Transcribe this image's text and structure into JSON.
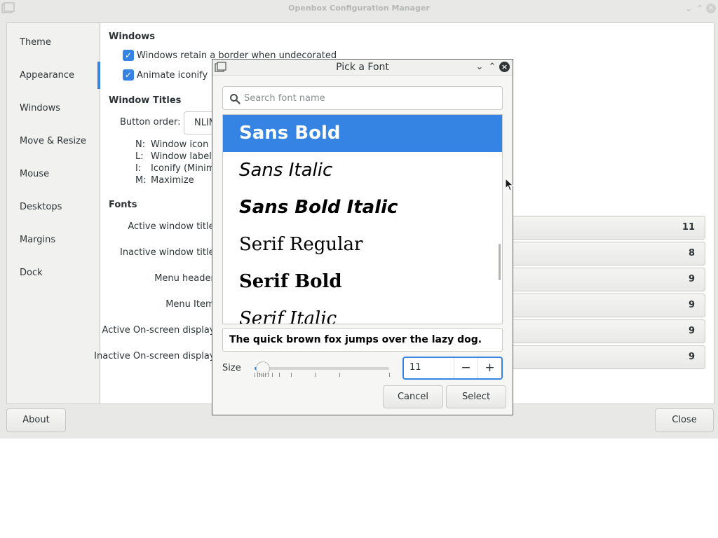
{
  "window": {
    "title": "Openbox Configuration Manager"
  },
  "sidebar": {
    "items": [
      {
        "label": "Theme"
      },
      {
        "label": "Appearance"
      },
      {
        "label": "Windows"
      },
      {
        "label": "Move & Resize"
      },
      {
        "label": "Mouse"
      },
      {
        "label": "Desktops"
      },
      {
        "label": "Margins"
      },
      {
        "label": "Dock"
      }
    ],
    "active": "Appearance"
  },
  "content": {
    "windows_section": {
      "title": "Windows",
      "check_border": "Windows retain a border when undecorated",
      "check_animate": "Animate iconify"
    },
    "titles_section": {
      "title": "Window Titles",
      "button_order_label": "Button order:",
      "button_order_value": "NLIM",
      "legend": [
        {
          "key": "N:",
          "value": "Window icon"
        },
        {
          "key": "L:",
          "value": "Window label"
        },
        {
          "key": "I:",
          "value": "Iconify (Minimize)"
        },
        {
          "key": "M:",
          "value": "Maximize"
        }
      ]
    },
    "fonts_section": {
      "title": "Fonts",
      "rows": [
        {
          "label": "Active window title:",
          "size": "11"
        },
        {
          "label": "Inactive window title:",
          "size": "8"
        },
        {
          "label": "Menu header:",
          "size": "9"
        },
        {
          "label": "Menu Item:",
          "size": "9"
        },
        {
          "label": "Active On-screen display:",
          "size": "9"
        },
        {
          "label": "Inactive On-screen display:",
          "size": "9"
        }
      ]
    }
  },
  "footer": {
    "about_label": "About",
    "close_label": "Close"
  },
  "dialog": {
    "title": "Pick a Font",
    "search_placeholder": "Search font name",
    "fonts": [
      {
        "label": "Sans Bold",
        "selected": true
      },
      {
        "label": "Sans Italic",
        "selected": false
      },
      {
        "label": "Sans Bold Italic",
        "selected": false
      },
      {
        "label": "Serif Regular",
        "selected": false
      },
      {
        "label": "Serif Bold",
        "selected": false
      },
      {
        "label": "Serif Italic",
        "selected": false
      }
    ],
    "preview_text": "The quick brown fox jumps over the lazy dog.",
    "size_label": "Size",
    "size_value": "11",
    "size_slider_fraction": 0.06,
    "minus_label": "−",
    "plus_label": "+",
    "cancel_label": "Cancel",
    "select_label": "Select"
  },
  "colors": {
    "accent": "#3584e4",
    "window_bg": "#e8e8e7",
    "text": "#2e3436"
  }
}
